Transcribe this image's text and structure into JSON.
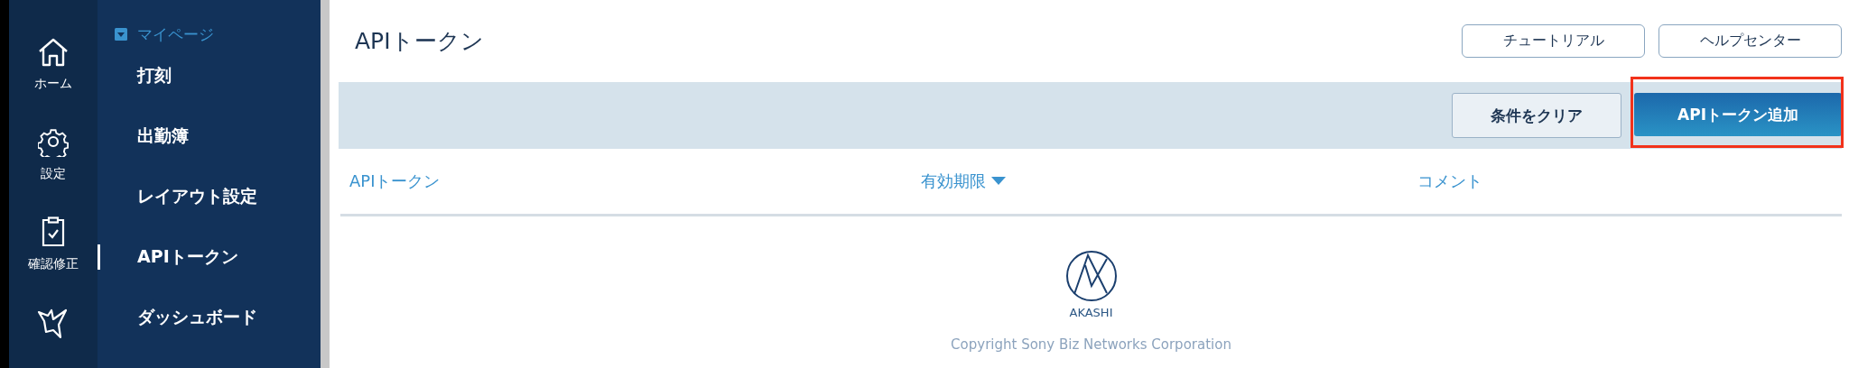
{
  "rail": [
    {
      "label": "ホーム"
    },
    {
      "label": "設定"
    },
    {
      "label": "確認修正"
    }
  ],
  "nav": {
    "header": "マイページ",
    "expanded": true,
    "items": [
      {
        "label": "打刻",
        "selected": false
      },
      {
        "label": "出勤簿",
        "selected": false
      },
      {
        "label": "レイアウト設定",
        "selected": false
      },
      {
        "label": "APIトークン",
        "selected": true
      },
      {
        "label": "ダッシュボード",
        "selected": false
      }
    ]
  },
  "page": {
    "title": "APIトークン",
    "header_buttons": [
      "チュートリアル",
      "ヘルプセンター"
    ]
  },
  "toolbar": {
    "clear_button": "条件をクリア",
    "add_button": {
      "label": "APIトークン追加",
      "highlighted": true
    }
  },
  "table": {
    "columns": [
      {
        "label": "APIトークン",
        "sorted": false
      },
      {
        "label": "有効期限",
        "sorted": true
      },
      {
        "label": "コメント",
        "sorted": false
      }
    ]
  },
  "footer": {
    "logo_text": "AKASHI",
    "copyright": "Copyright Sony Biz Networks Corporation"
  }
}
